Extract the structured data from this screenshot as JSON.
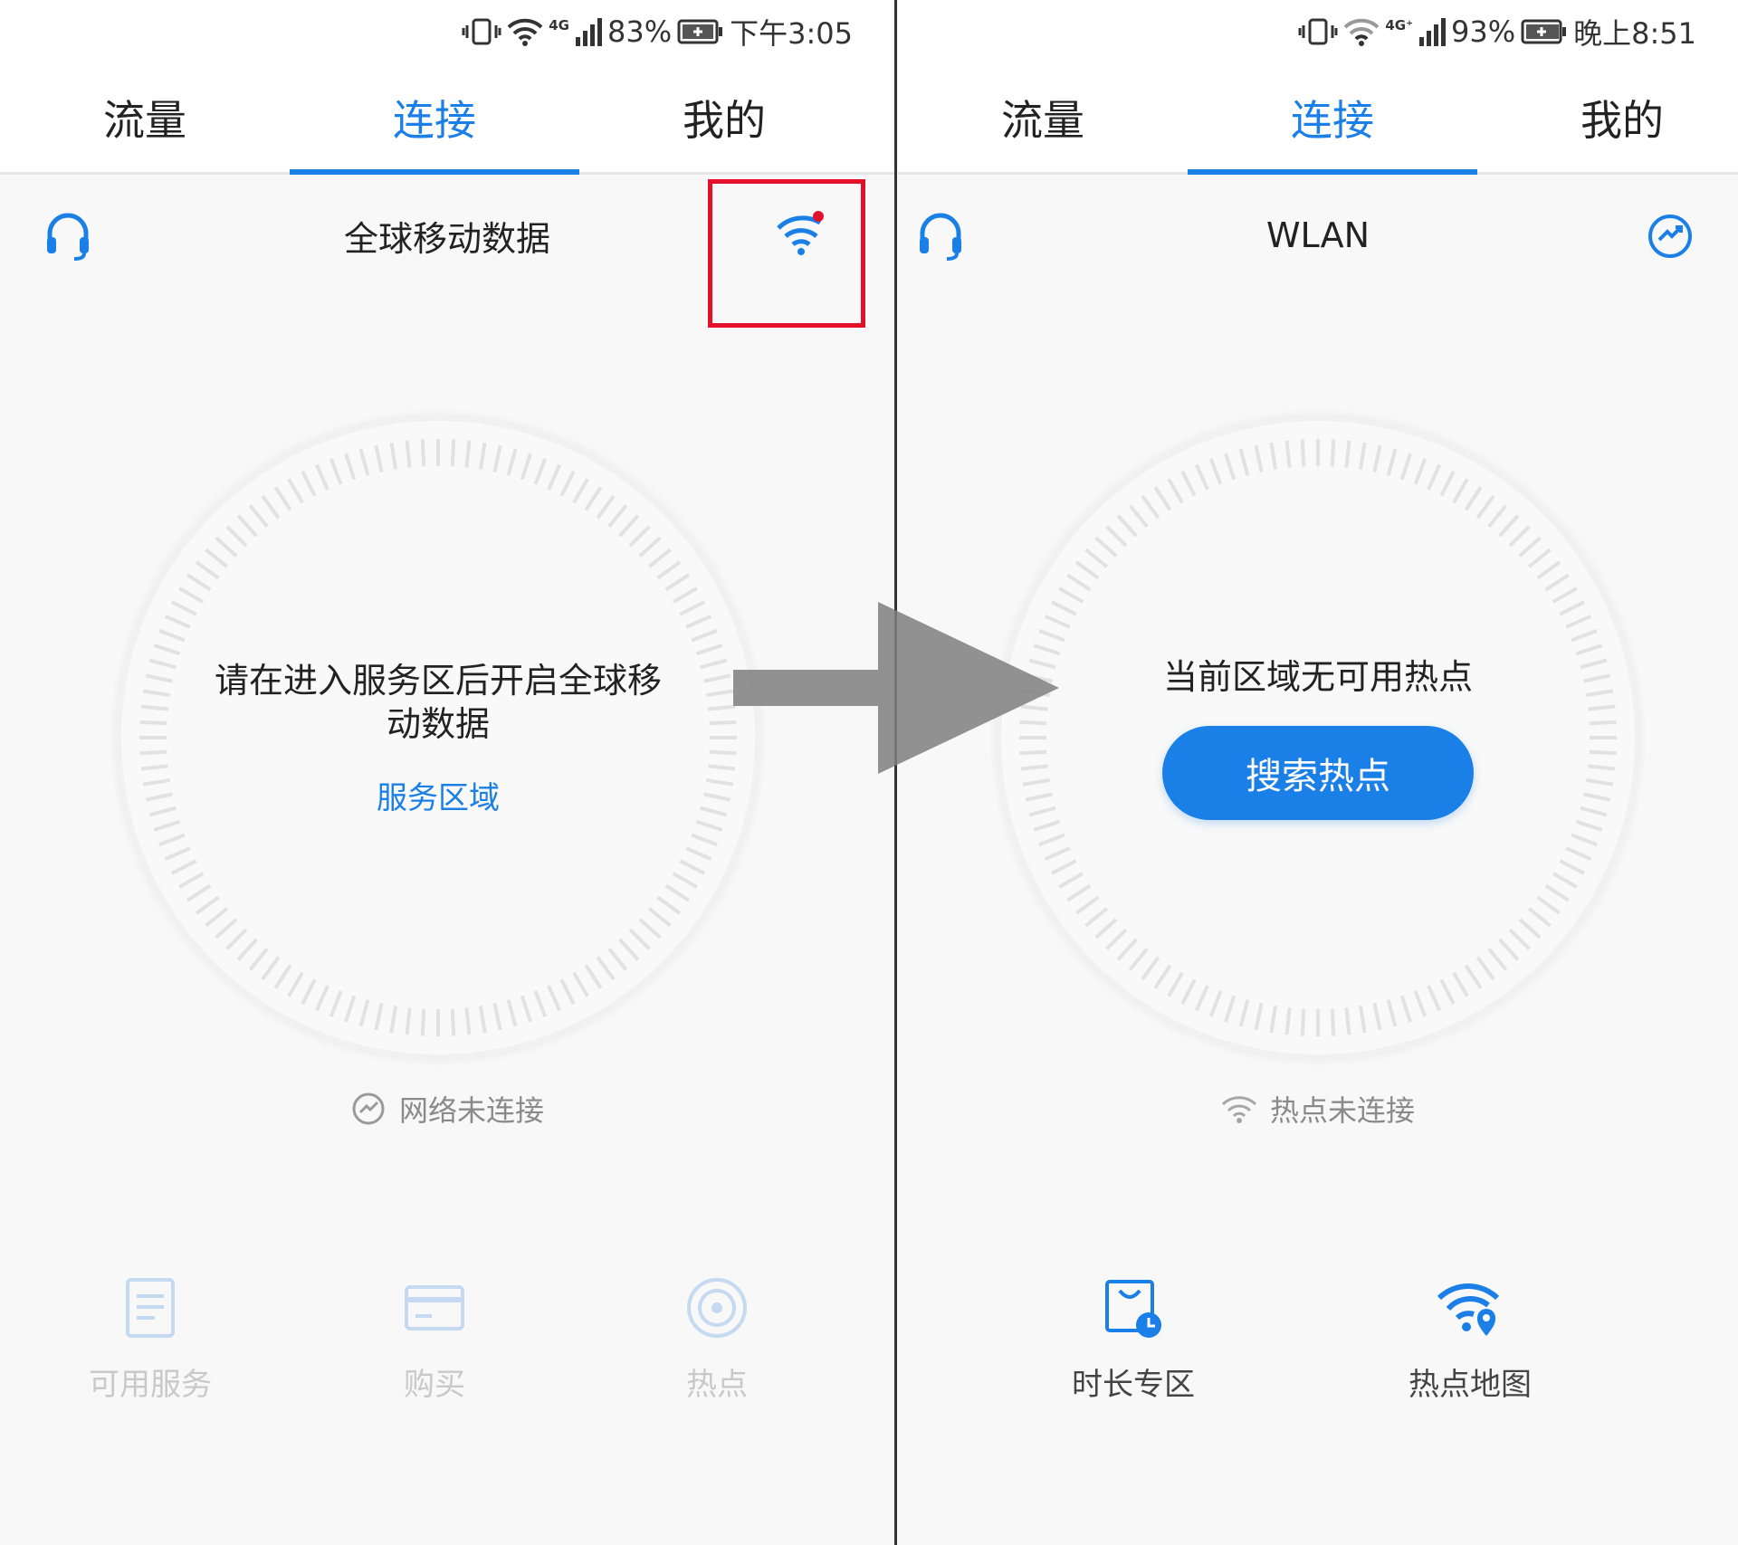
{
  "colors": {
    "accent": "#1a7fe6",
    "highlight_box": "#e3122b",
    "notification_dot": "#e3122b",
    "disabled": "#c9c9c9",
    "arrow": "#808080"
  },
  "left": {
    "status_bar": {
      "network": "4G",
      "battery": "83%",
      "time": "下午3:05"
    },
    "tabs": [
      {
        "label": "流量",
        "active": false
      },
      {
        "label": "连接",
        "active": true
      },
      {
        "label": "我的",
        "active": false
      }
    ],
    "header": {
      "title": "全球移动数据",
      "left_icon": "headset-icon",
      "right_icon": "wifi-icon",
      "right_icon_badge": true
    },
    "dial": {
      "message": "请在进入服务区后开启全球移动数据",
      "link": "服务区域"
    },
    "status": {
      "icon": "network-disconnected-icon",
      "text": "网络未连接"
    },
    "bottom_nav": [
      {
        "label": "可用服务",
        "icon": "document-icon",
        "enabled": false
      },
      {
        "label": "购买",
        "icon": "card-icon",
        "enabled": false
      },
      {
        "label": "热点",
        "icon": "hotspot-icon",
        "enabled": false
      }
    ]
  },
  "right": {
    "status_bar": {
      "network": "4G⁺",
      "battery": "93%",
      "time": "晚上8:51"
    },
    "tabs": [
      {
        "label": "流量",
        "active": false
      },
      {
        "label": "连接",
        "active": true
      },
      {
        "label": "我的",
        "active": false
      }
    ],
    "header": {
      "title": "WLAN",
      "left_icon": "headset-icon",
      "right_icon": "switch-icon"
    },
    "dial": {
      "message": "当前区域无可用热点",
      "button": "搜索热点"
    },
    "status": {
      "icon": "wifi-icon",
      "text": "热点未连接"
    },
    "bottom_nav": [
      {
        "label": "时长专区",
        "icon": "time-bag-icon",
        "enabled": true
      },
      {
        "label": "热点地图",
        "icon": "wifi-map-icon",
        "enabled": true
      }
    ]
  }
}
